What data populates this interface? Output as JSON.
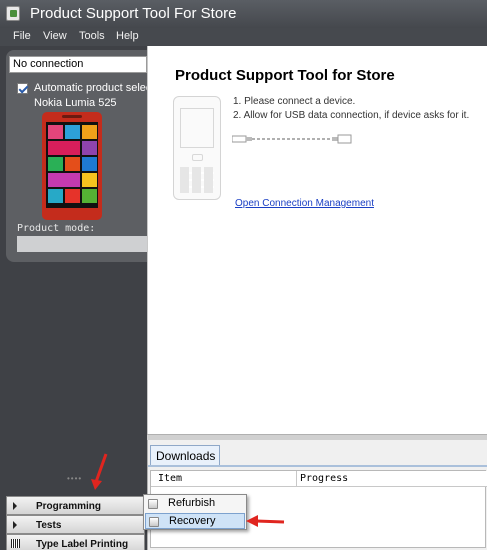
{
  "window": {
    "title": "Product Support Tool For Store"
  },
  "menu": [
    "File",
    "View",
    "Tools",
    "Help"
  ],
  "sidebar": {
    "connection": "No connection",
    "auto_select_label": "Automatic product selection",
    "model": "Nokia Lumia 525",
    "mode_label": "Product mode:",
    "mode_value": "",
    "nav": [
      "Programming",
      "Tests",
      "Type Label Printing"
    ]
  },
  "main": {
    "title": "Product Support Tool for Store",
    "step1": "1. Please connect a device.",
    "step2": "2. Allow for USB data connection, if device asks for it.",
    "link": "Open Connection Management"
  },
  "downloads": {
    "tab": "Downloads",
    "columns": [
      "Item",
      "Progress"
    ]
  },
  "popup": {
    "items": [
      "Refurbish",
      "Recovery"
    ],
    "highlighted": "Recovery"
  },
  "colors": {
    "arrow": "#e0251f",
    "link": "#1a3fc4",
    "highlight": "#cfe3f7"
  }
}
